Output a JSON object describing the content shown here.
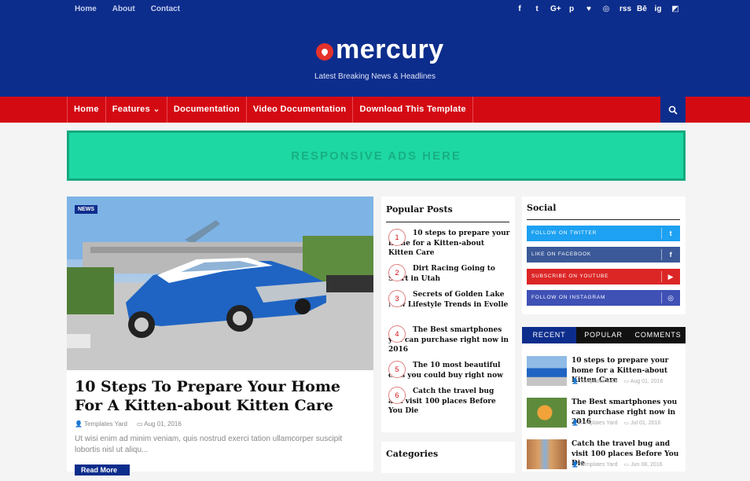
{
  "top_nav": [
    "Home",
    "About",
    "Contact"
  ],
  "top_social": [
    "f",
    "t",
    "G+",
    "p",
    "♥",
    "◎",
    "rss",
    "Bē",
    "ig",
    "◩"
  ],
  "logo": {
    "text": "mercury"
  },
  "tagline": "Latest Breaking News & Headlines",
  "main_nav": [
    "Home",
    "Features",
    "Documentation",
    "Video Documentation",
    "Download This Template"
  ],
  "features_caret": "⌄",
  "search_icon": "⌕",
  "ads": {
    "text": "RESPONSIVE ADS HERE"
  },
  "featured": {
    "badge": "NEWS",
    "title": "10 Steps To Prepare Your Home For A Kitten-about Kitten Care",
    "author": "Templates Yard",
    "date": "Aug 01, 2016",
    "excerpt": "Ut wisi enim ad minim veniam, quis nostrud exerci tation ullamcorper suscipit lobortis nisl ut aliqu...",
    "read_more": "Read More"
  },
  "popular_posts": {
    "title": "Popular Posts",
    "items": [
      {
        "num": "1",
        "text": "10 steps to prepare your home for a Kitten-about Kitten Care"
      },
      {
        "num": "2",
        "text": "Dirt Racing Going to Start in Utah"
      },
      {
        "num": "3",
        "text": "Secrets of Golden Lake New Lifestyle Trends in Evolle"
      },
      {
        "num": "4",
        "text": "The Best smartphones you can purchase right now in 2016"
      },
      {
        "num": "5",
        "text": "The 10 most beautiful cars you could buy right now"
      },
      {
        "num": "6",
        "text": "Catch the travel bug and visit 100 places Before You Die"
      }
    ]
  },
  "categories": {
    "title": "Categories"
  },
  "social": {
    "title": "Social",
    "buttons": [
      {
        "label": "FOLLOW ON TWITTER",
        "icon": "t",
        "color": "#1da1f2"
      },
      {
        "label": "LIKE ON FACEBOOK",
        "icon": "f",
        "color": "#3b5998"
      },
      {
        "label": "SUBSCRIBE ON YOUTUBE",
        "icon": "▶",
        "color": "#dc2626"
      },
      {
        "label": "FOLLOW ON INSTAGRAM",
        "icon": "◎",
        "color": "#3f51b5"
      }
    ]
  },
  "tabs": [
    {
      "label": "RECENT",
      "color": "#0d2d8c"
    },
    {
      "label": "POPULAR",
      "color": "#111111"
    },
    {
      "label": "COMMENTS",
      "color": "#111111"
    }
  ],
  "recent_posts": [
    {
      "title": "10 steps to prepare your home for a Kitten-about Kitten Care",
      "author": "Templates Yard",
      "date": "Aug 01, 2016"
    },
    {
      "title": "The Best smartphones you can purchase right now in 2016",
      "author": "Templates Yard",
      "date": "Jul 01, 2016"
    },
    {
      "title": "Catch the travel bug and visit 100 places Before You Die",
      "author": "Templates Yard",
      "date": "Jun 08, 2016"
    }
  ],
  "colors": {
    "header": "#0d2d8c",
    "nav": "#d40a13",
    "ads": "#1ed8a3"
  }
}
